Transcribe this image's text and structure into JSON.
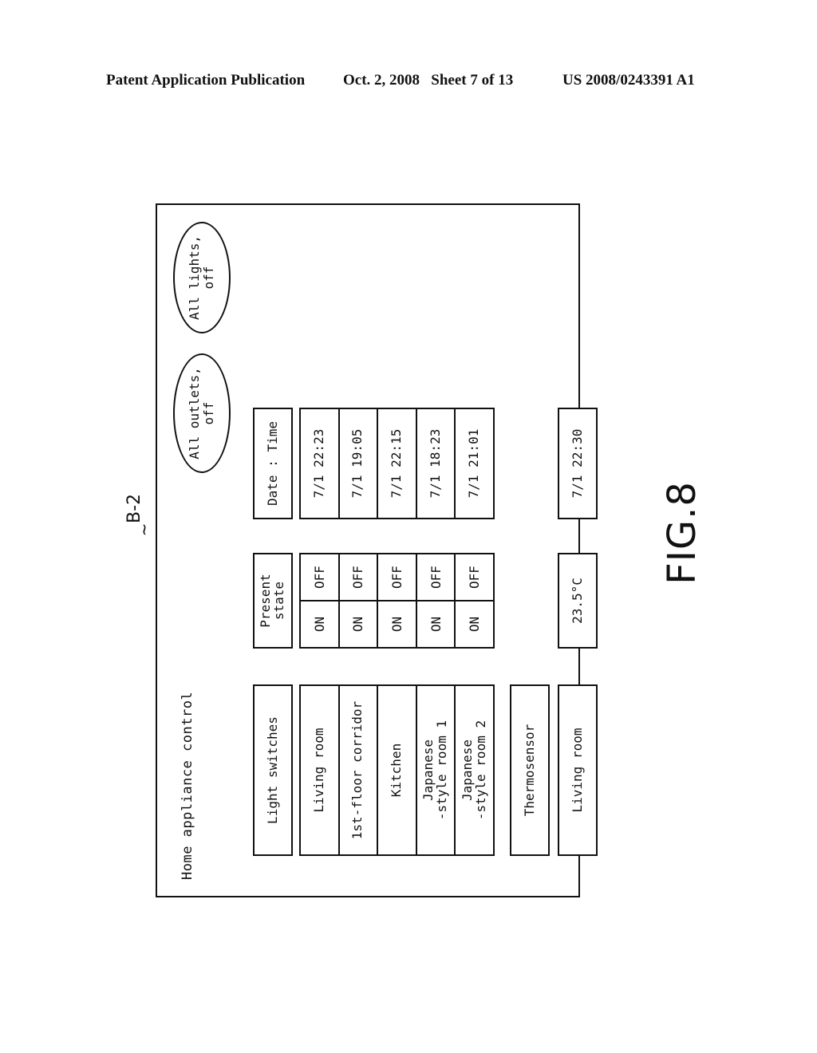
{
  "header": {
    "left": "Patent Application Publication",
    "date_sheet": "Oct. 2, 2008   Sheet 7 of 13",
    "number": "US 2008/0243391 A1"
  },
  "reference_label": "B-2",
  "reference_tilde": "~",
  "figure_label": "FIG.8",
  "screen": {
    "title": "Home appliance control",
    "buttons": {
      "all_outlets_off": "All outlets,\noff",
      "all_lights_off": "All lights,\noff"
    },
    "light_switches": {
      "header": "Light switches",
      "state_header": "Present\nstate",
      "datetime_header": "Date : Time",
      "rows": [
        {
          "room": "Living room",
          "on_label": "ON",
          "off_label": "OFF",
          "datetime": "7/1 22:23"
        },
        {
          "room": "1st-floor corridor",
          "on_label": "ON",
          "off_label": "OFF",
          "datetime": "7/1 19:05"
        },
        {
          "room": "Kitchen",
          "on_label": "ON",
          "off_label": "OFF",
          "datetime": "7/1 22:15"
        },
        {
          "room": "Japanese\n-style room 1",
          "on_label": "ON",
          "off_label": "OFF",
          "datetime": "7/1 18:23"
        },
        {
          "room": "Japanese\n-style room 2",
          "on_label": "ON",
          "off_label": "OFF",
          "datetime": "7/1 21:01"
        }
      ]
    },
    "thermosensor": {
      "header": "Thermosensor",
      "rows": [
        {
          "room": "Living room",
          "temperature": "23.5°C",
          "datetime": "7/1 22:30"
        }
      ]
    }
  }
}
